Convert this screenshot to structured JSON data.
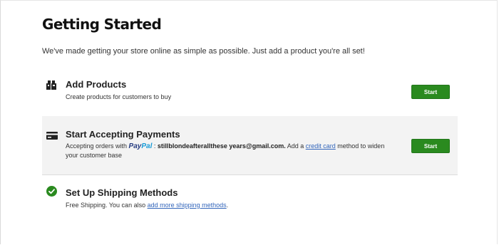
{
  "page": {
    "title": "Getting Started",
    "subtitle": "We've made getting your store online as simple as possible. Just add a product you're all set!"
  },
  "steps": [
    {
      "title": "Add Products",
      "description": "Create products for customers to buy",
      "button_label": "Start",
      "icon": "boxes-icon"
    },
    {
      "title": "Start Accepting Payments",
      "description_prefix": "Accepting orders with ",
      "paypal_part1": "Pay",
      "paypal_part2": "Pal",
      "separator": " : ",
      "email": "stillblondeafterallthese years@gmail.com.",
      "description_mid": " Add a ",
      "link_text": "credit card",
      "description_suffix": " method to widen your customer base",
      "button_label": "Start",
      "icon": "credit-card-icon"
    },
    {
      "title": "Set Up Shipping Methods",
      "description_prefix": "Free Shipping. You can also ",
      "link_text": "add more shipping methods",
      "description_suffix": ".",
      "icon": "check-circle-icon",
      "status_color": "#2a8a1f"
    }
  ],
  "colors": {
    "button": "#2a8a1f",
    "link": "#3366bb",
    "highlight_bg": "#f3f3f3"
  }
}
